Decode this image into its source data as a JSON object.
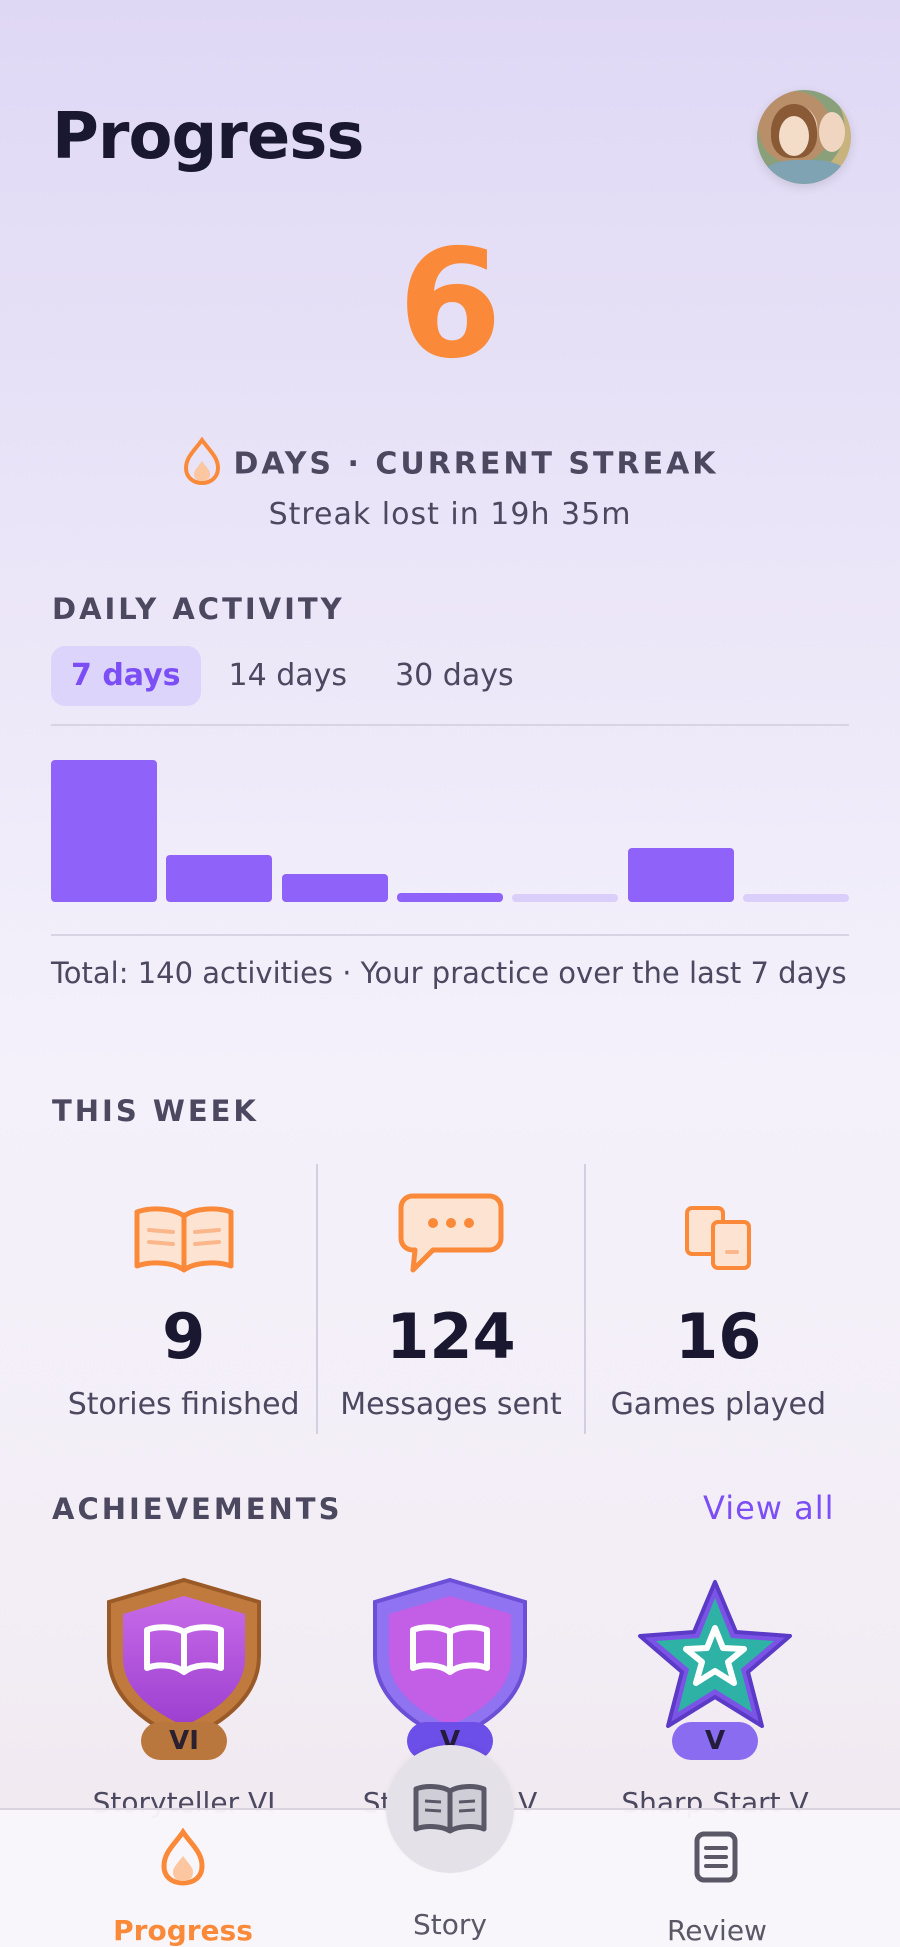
{
  "header": {
    "title": "Progress"
  },
  "streak": {
    "count": "6",
    "label": "DAYS · CURRENT STREAK",
    "lost_in": "Streak lost in 19h 35m"
  },
  "daily_activity": {
    "heading": "DAILY ACTIVITY",
    "tabs": [
      {
        "label": "7 days",
        "active": true
      },
      {
        "label": "14 days",
        "active": false
      },
      {
        "label": "30 days",
        "active": false
      }
    ],
    "total_text": "Total:  140 activities · Your practice over the last 7 days"
  },
  "chart_data": {
    "type": "bar",
    "title": "",
    "xlabel": "",
    "ylabel": "",
    "categories": [
      "",
      "",
      "",
      "",
      "",
      "",
      ""
    ],
    "values": [
      60,
      20,
      12,
      4,
      1,
      23,
      1
    ],
    "colors": {
      "active": "#8f63fa",
      "empty": "#d9cffa"
    }
  },
  "this_week": {
    "heading": "THIS WEEK",
    "stats": [
      {
        "icon": "open-book-icon",
        "value": "9",
        "label": "Stories finished"
      },
      {
        "icon": "chat-bubble-icon",
        "value": "124",
        "label": "Messages sent"
      },
      {
        "icon": "game-cards-icon",
        "value": "16",
        "label": "Games played"
      }
    ]
  },
  "achievements": {
    "heading": "ACHIEVEMENTS",
    "view_all": "View all",
    "items": [
      {
        "icon": "storyteller-badge-icon",
        "level": "VI",
        "caption": "Storyteller VI"
      },
      {
        "icon": "story-badge-icon",
        "level": "V",
        "caption": "Storyteller V"
      },
      {
        "icon": "star-badge-icon",
        "level": "V",
        "caption": "Sharp Start V"
      }
    ]
  },
  "bottom_nav": {
    "items": [
      {
        "label": "Progress",
        "icon": "flame-icon",
        "active": true
      },
      {
        "label": "Story",
        "icon": "book-icon",
        "active": false
      },
      {
        "label": "Review",
        "icon": "notes-icon",
        "active": false
      }
    ]
  },
  "colors": {
    "accent": "#fa8a3a",
    "primary": "#7c4ef5"
  }
}
